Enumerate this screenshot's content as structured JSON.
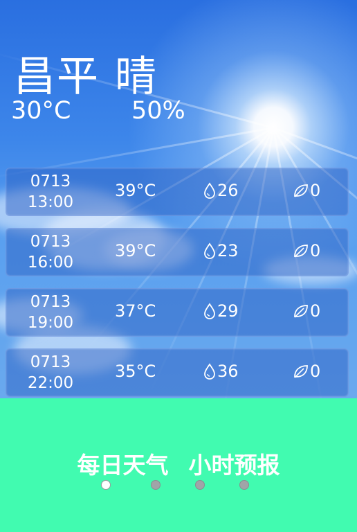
{
  "current": {
    "city": "昌平",
    "condition": "晴",
    "temperature": "30°C",
    "humidity": "50%"
  },
  "forecast": [
    {
      "date": "0713",
      "time": "13:00",
      "temp": "39°C",
      "rain": "26",
      "wind": "0"
    },
    {
      "date": "0713",
      "time": "16:00",
      "temp": "39°C",
      "rain": "23",
      "wind": "0"
    },
    {
      "date": "0713",
      "time": "19:00",
      "temp": "37°C",
      "rain": "29",
      "wind": "0"
    },
    {
      "date": "0713",
      "time": "22:00",
      "temp": "35°C",
      "rain": "36",
      "wind": "0"
    }
  ],
  "tabs": [
    "每日天气",
    "小时预报"
  ],
  "pager": {
    "count": 4,
    "active": 0
  },
  "colors": {
    "bottom_bar": "#41fbb0",
    "sky": "#2a6fe0"
  },
  "icons": {
    "rain": "droplet-icon",
    "wind": "leaf-icon"
  }
}
